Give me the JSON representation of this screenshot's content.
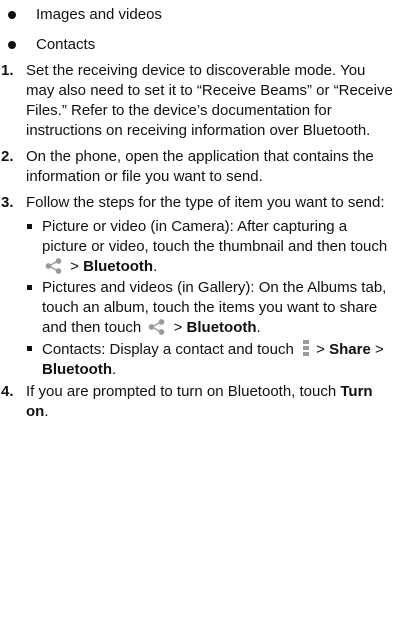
{
  "bullets": [
    "Images and videos",
    "Contacts"
  ],
  "steps": [
    {
      "num": "1.",
      "text": "Set the receiving device to discoverable mode. You may also need to set it to “Receive Beams” or “Receive Files.” Refer to the device’s documentation for instructions on receiving information over Bluetooth."
    },
    {
      "num": "2.",
      "text": "On the phone, open the application that contains the information or file you want to send."
    },
    {
      "num": "3.",
      "text": "Follow the steps for the type of item you want to send:",
      "subs": [
        {
          "pre": "Picture or video (in Camera): After capturing a picture or video, touch the thumbnail and then touch",
          "sep": ">",
          "b1": "Bluetooth",
          "end": "."
        },
        {
          "pre": "Pictures and videos (in Gallery): On the Albums tab, touch an album, touch the items you want to share and then touch",
          "sep": ">",
          "b1": "Bluetooth",
          "end": "."
        },
        {
          "pre": "Contacts: Display a contact and touch",
          "sep1": ">",
          "b1": "Share",
          "sep2": ">",
          "b2": "Bluetooth",
          "end": "."
        }
      ]
    },
    {
      "num": "4.",
      "pre": "If you are prompted to turn on Bluetooth, touch",
      "b1": "Turn on",
      "end": "."
    }
  ],
  "icons": {
    "share": "share-icon",
    "menu": "menu-icon",
    "icon_color": "#9a9a9a"
  }
}
